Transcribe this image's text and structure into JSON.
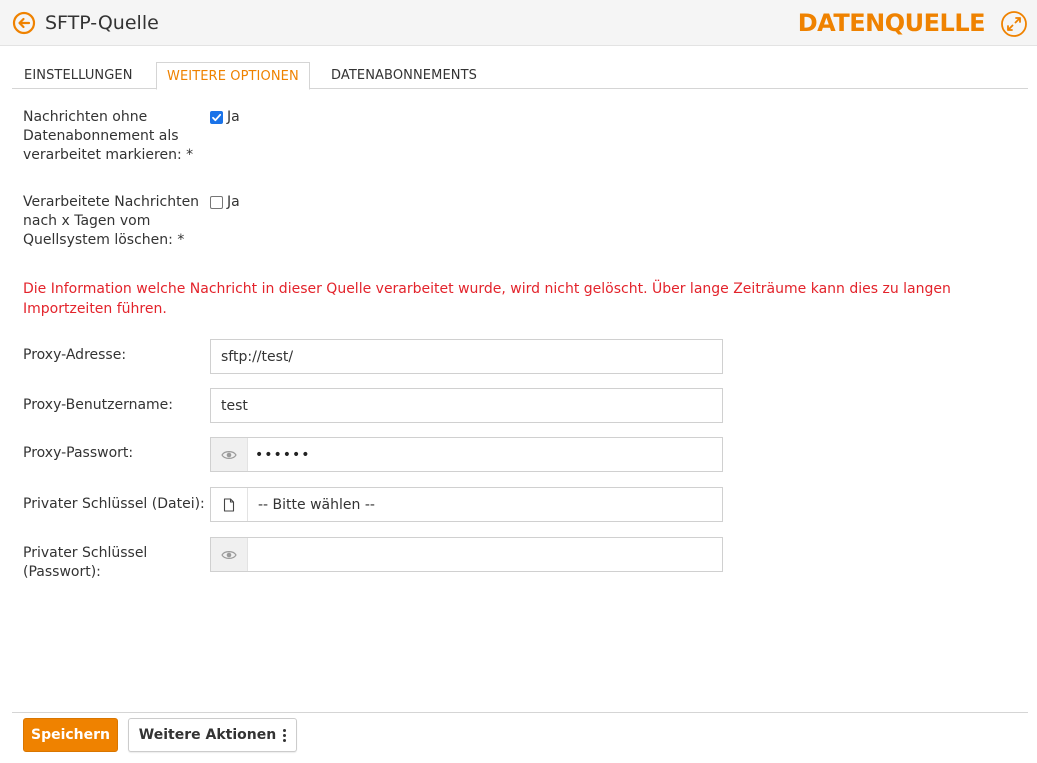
{
  "header": {
    "title": "SFTP-Quelle",
    "section": "DATENQUELLE"
  },
  "tabs": [
    {
      "label": "EINSTELLUNGEN",
      "active": false
    },
    {
      "label": "WEITERE OPTIONEN",
      "active": true
    },
    {
      "label": "DATENABONNEMENTS",
      "active": false
    }
  ],
  "options": {
    "mark_processed": {
      "label_lines": [
        "Nachrichten ohne",
        "Datenabonnement als",
        "verarbeitet markieren: *"
      ],
      "checkbox_label": "Ja",
      "checked": true
    },
    "delete_after_days": {
      "label_lines": [
        "Verarbeitete Nachrichten",
        "nach x Tagen vom",
        "Quellsystem löschen: *"
      ],
      "checkbox_label": "Ja",
      "checked": false
    }
  },
  "warning_text": "Die Information welche Nachricht in dieser Quelle verarbeitet wurde, wird nicht gelöscht. Über lange Zeiträume kann dies zu langen Importzeiten führen.",
  "proxy": {
    "address_label": "Proxy-Adresse:",
    "address_value": "sftp://test/",
    "username_label": "Proxy-Benutzername:",
    "username_value": "test",
    "password_label": "Proxy-Passwort:",
    "password_masked": "••••••",
    "private_key_file_label": "Privater Schlüssel (Datei):",
    "private_key_file_value": "-- Bitte wählen --",
    "private_key_password_label_lines": [
      "Privater Schlüssel",
      "(Passwort):"
    ],
    "private_key_password_value": ""
  },
  "footer": {
    "save_label": "Speichern",
    "more_actions_label": "Weitere Aktionen"
  },
  "colors": {
    "accent": "#ef8200",
    "warning": "#e3232b",
    "checkbox": "#1a73e8"
  },
  "icons": {
    "back": "arrow-left-circle-icon",
    "expand": "expand-arrows-icon",
    "eye": "eye-icon",
    "file": "file-icon",
    "kebab": "vertical-dots-icon"
  }
}
